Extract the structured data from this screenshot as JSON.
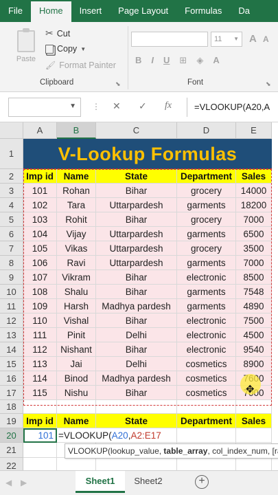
{
  "menu": {
    "tabs": [
      "File",
      "Home",
      "Insert",
      "Page Layout",
      "Formulas",
      "Da"
    ],
    "active": "Home"
  },
  "ribbon": {
    "clipboard": {
      "paste": "Paste",
      "cut": "Cut",
      "copy": "Copy",
      "format_painter": "Format Painter",
      "label": "Clipboard"
    },
    "font": {
      "size": "11",
      "bold": "B",
      "italic": "I",
      "underline": "U",
      "label": "Font",
      "next_group": "A"
    }
  },
  "formula_bar": {
    "cancel": "✕",
    "enter": "✓",
    "fx": "fx",
    "formula": "=VLOOKUP(A20,A"
  },
  "columns": [
    "A",
    "B",
    "C",
    "D",
    "E"
  ],
  "rows": [
    "1",
    "2",
    "3",
    "4",
    "5",
    "6",
    "7",
    "8",
    "9",
    "10",
    "11",
    "12",
    "13",
    "14",
    "15",
    "16",
    "17",
    "18",
    "19",
    "20",
    "21",
    "22"
  ],
  "title": "V-Lookup Formulas",
  "table": {
    "headers": [
      "Imp id",
      "Name",
      "State",
      "Department",
      "Sales"
    ],
    "rows": [
      [
        "101",
        "Rohan",
        "Bihar",
        "grocery",
        "14000"
      ],
      [
        "102",
        "Tara",
        "Uttarpardesh",
        "garments",
        "18200"
      ],
      [
        "103",
        "Rohit",
        "Bihar",
        "grocery",
        "7000"
      ],
      [
        "104",
        "Vijay",
        "Uttarpardesh",
        "garments",
        "6500"
      ],
      [
        "105",
        "Vikas",
        "Uttarpardesh",
        "grocery",
        "3500"
      ],
      [
        "106",
        "Ravi",
        "Uttarpardesh",
        "garments",
        "7000"
      ],
      [
        "107",
        "Vikram",
        "Bihar",
        "electronic",
        "8500"
      ],
      [
        "108",
        "Shalu",
        "Bihar",
        "garments",
        "7548"
      ],
      [
        "109",
        "Harsh",
        "Madhya pardesh",
        "garments",
        "4890"
      ],
      [
        "110",
        "Vishal",
        "Bihar",
        "electronic",
        "7500"
      ],
      [
        "111",
        "Pinit",
        "Delhi",
        "electronic",
        "4500"
      ],
      [
        "112",
        "Nishant",
        "Bihar",
        "electronic",
        "9540"
      ],
      [
        "113",
        "Jai",
        "Delhi",
        "cosmetics",
        "8900"
      ],
      [
        "114",
        "Binod",
        "Madhya pardesh",
        "cosmetics",
        "7600"
      ],
      [
        "115",
        "Nishu",
        "Bihar",
        "cosmetics",
        "7000"
      ]
    ]
  },
  "lookup": {
    "headers": [
      "Imp id",
      "Name",
      "State",
      "Department",
      "Sales"
    ],
    "input_id": "101",
    "edit_prefix": "=VLOOKUP(",
    "edit_arg1": "A20",
    "edit_comma": ",",
    "edit_arg2": "A2:E17"
  },
  "tooltip": {
    "fn": "VLOOKUP(",
    "arg1": "lookup_value, ",
    "arg2": "table_array",
    "rest": ", col_index_num, [range_lookup])"
  },
  "sheets": [
    "Sheet1",
    "Sheet2"
  ],
  "active_sheet": "Sheet1",
  "colors": {
    "excel_green": "#217346",
    "title_bg": "#1f4e79",
    "title_fg": "#ffc000",
    "header_yellow": "#ffff00",
    "data_pink": "#fbe5e8",
    "ref_blue": "#2f6fd6",
    "ref_red": "#c0392b"
  }
}
